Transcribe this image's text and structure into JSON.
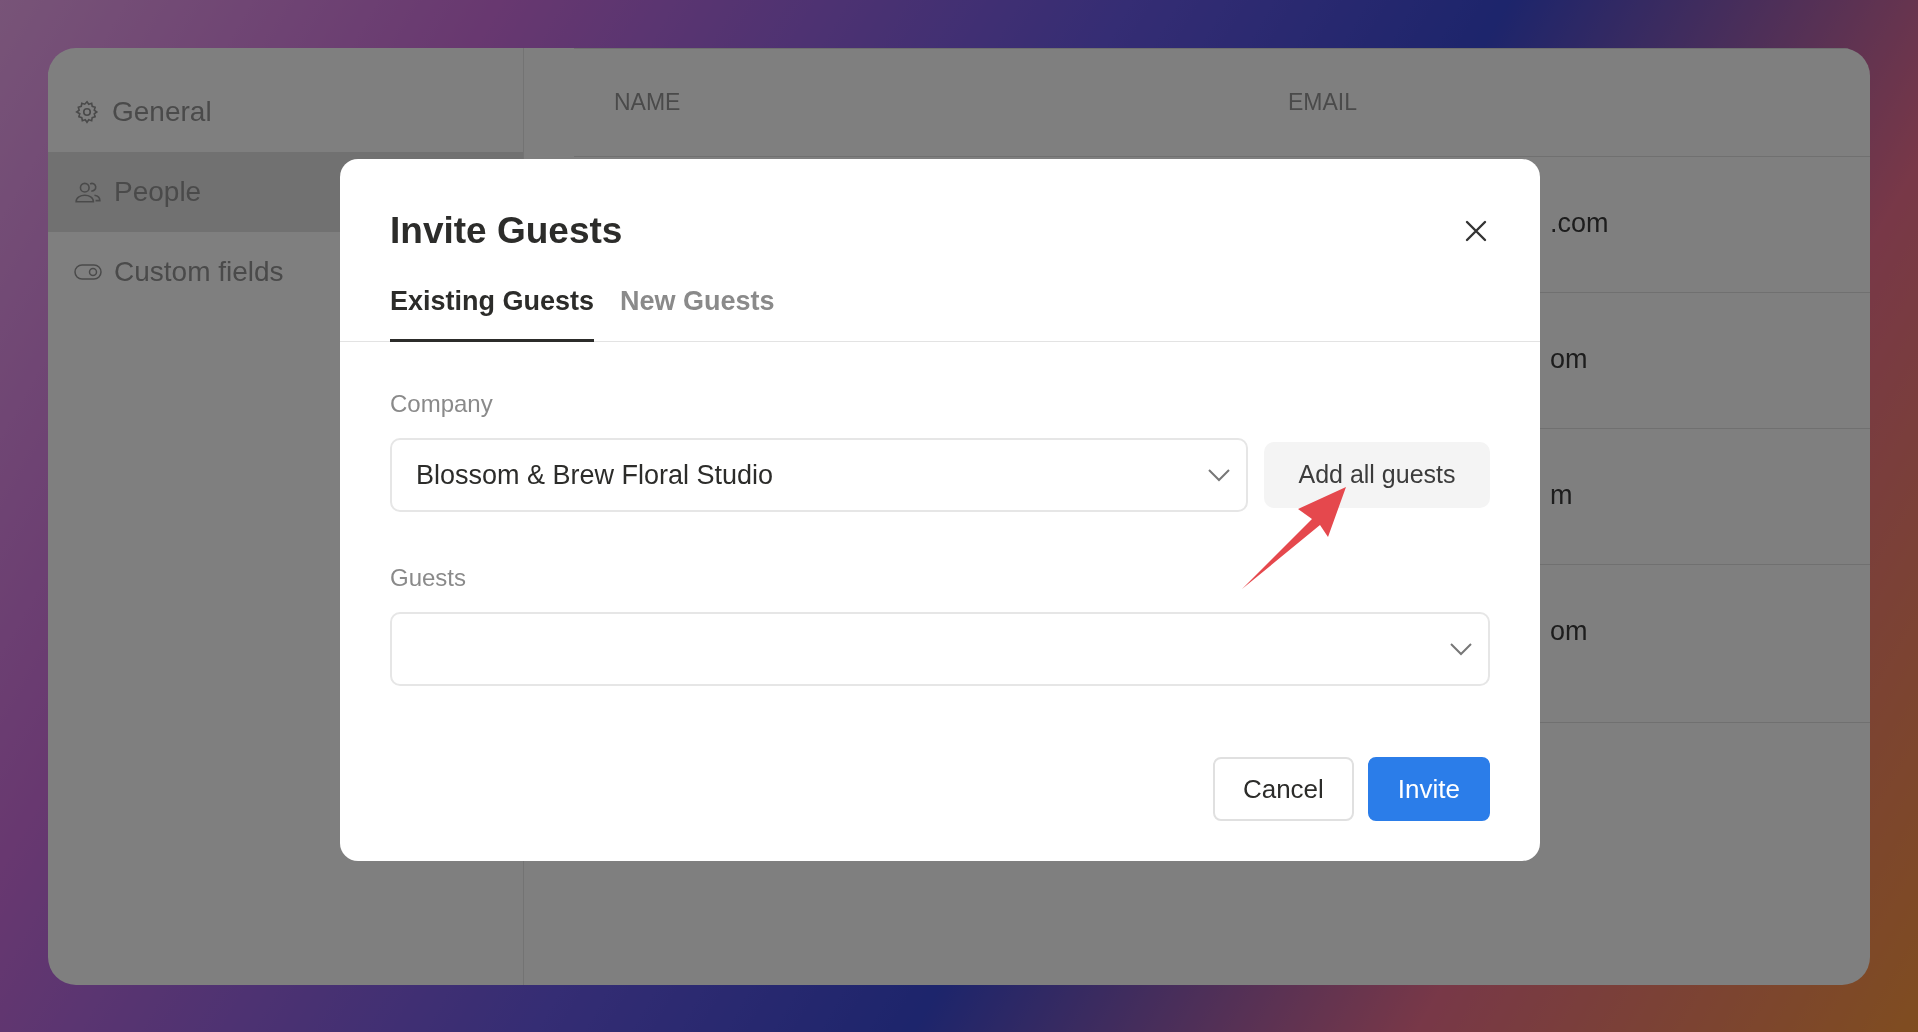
{
  "sidebar": {
    "items": [
      {
        "label": "General",
        "selected": false
      },
      {
        "label": "People",
        "selected": true
      },
      {
        "label": "Custom fields",
        "selected": false
      }
    ]
  },
  "table": {
    "columns": [
      "NAME",
      "EMAIL"
    ],
    "rows": [
      {
        "email": ".com"
      },
      {
        "email": "om"
      },
      {
        "email": "m"
      },
      {
        "email": "om"
      }
    ]
  },
  "modal": {
    "title": "Invite Guests",
    "tabs": [
      {
        "label": "Existing Guests",
        "selected": true
      },
      {
        "label": "New Guests",
        "selected": false
      }
    ],
    "company": {
      "label": "Company",
      "value": "Blossom & Brew Floral Studio"
    },
    "add_all_button": "Add all guests",
    "guests": {
      "label": "Guests"
    },
    "buttons": [
      {
        "label": "Cancel",
        "kind": "secondary"
      },
      {
        "label": "Invite",
        "kind": "primary"
      }
    ]
  }
}
